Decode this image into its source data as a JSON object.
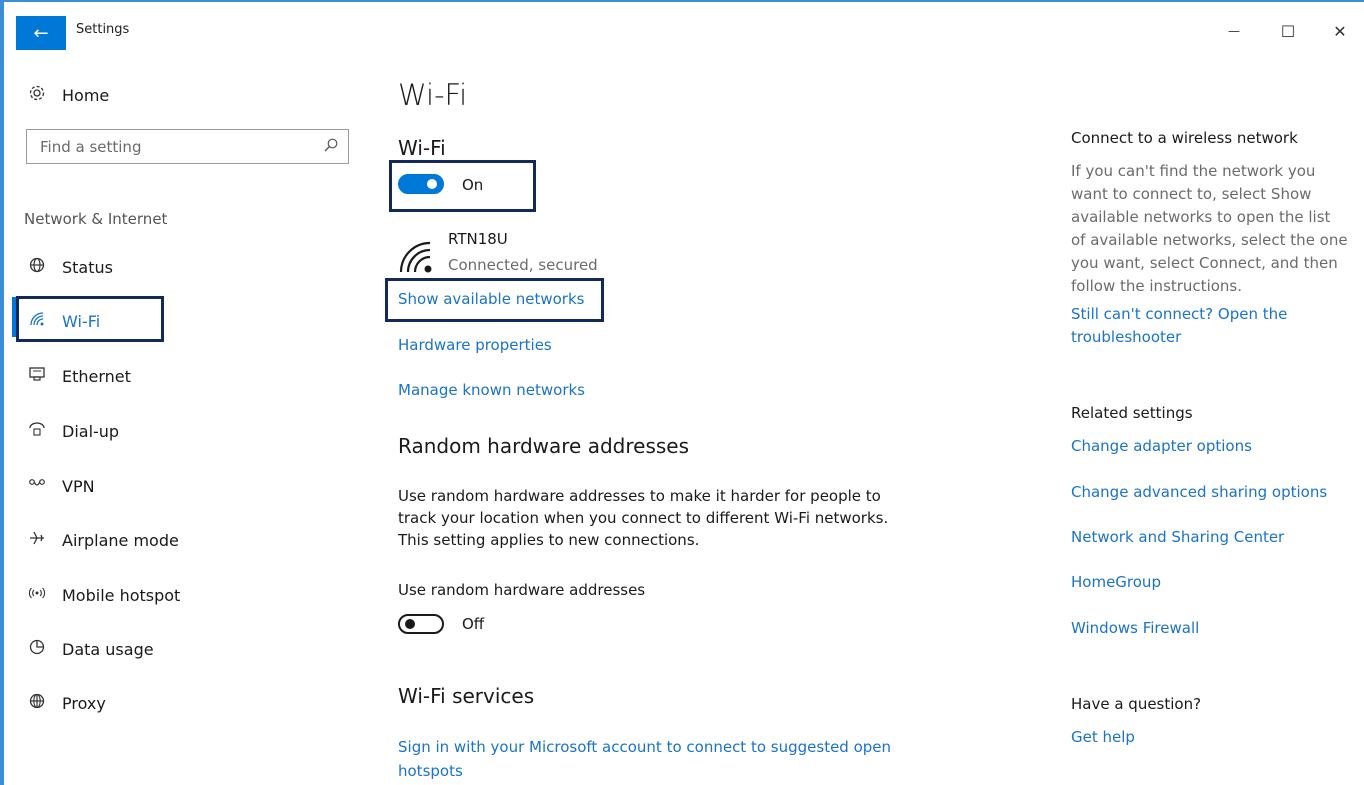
{
  "window": {
    "title": "Settings",
    "back_icon": "←",
    "minimize_icon": "—",
    "maximize_icon": "☐",
    "close_icon": "✕",
    "accent_color": "#0078d7"
  },
  "sidebar": {
    "home_label": "Home",
    "search_placeholder": "Find a setting",
    "section_title": "Network & Internet",
    "items": [
      {
        "label": "Status",
        "icon": "globe-icon"
      },
      {
        "label": "Wi-Fi",
        "icon": "wifi-icon",
        "selected": true
      },
      {
        "label": "Ethernet",
        "icon": "ethernet-icon"
      },
      {
        "label": "Dial-up",
        "icon": "dialup-icon"
      },
      {
        "label": "VPN",
        "icon": "vpn-icon"
      },
      {
        "label": "Airplane mode",
        "icon": "airplane-icon"
      },
      {
        "label": "Mobile hotspot",
        "icon": "hotspot-icon"
      },
      {
        "label": "Data usage",
        "icon": "data-usage-icon"
      },
      {
        "label": "Proxy",
        "icon": "proxy-icon"
      }
    ]
  },
  "main": {
    "page_title": "Wi-Fi",
    "wifi_section_title": "Wi-Fi",
    "wifi_toggle_state": "On",
    "network": {
      "name": "RTN18U",
      "status": "Connected, secured"
    },
    "links": {
      "show_networks": "Show available networks",
      "hardware_properties": "Hardware properties",
      "manage_known": "Manage known networks"
    },
    "random_hw": {
      "title": "Random hardware addresses",
      "description": "Use random hardware addresses to make it harder for people to track your location when you connect to different Wi-Fi networks. This setting applies to new connections.",
      "toggle_label": "Use random hardware addresses",
      "toggle_state": "Off"
    },
    "services": {
      "title": "Wi-Fi services",
      "link": "Sign in with your Microsoft account to connect to suggested open hotspots"
    }
  },
  "right_panel": {
    "connect_title": "Connect to a wireless network",
    "connect_text": "If you can't find the network you want to connect to, select Show available networks to open the list of available networks, select the one you want, select Connect, and then follow the instructions.",
    "troubleshoot_link": "Still can't connect? Open the troubleshooter",
    "related_title": "Related settings",
    "related_links": [
      "Change adapter options",
      "Change advanced sharing options",
      "Network and Sharing Center",
      "HomeGroup",
      "Windows Firewall"
    ],
    "question_title": "Have a question?",
    "help_link": "Get help"
  }
}
